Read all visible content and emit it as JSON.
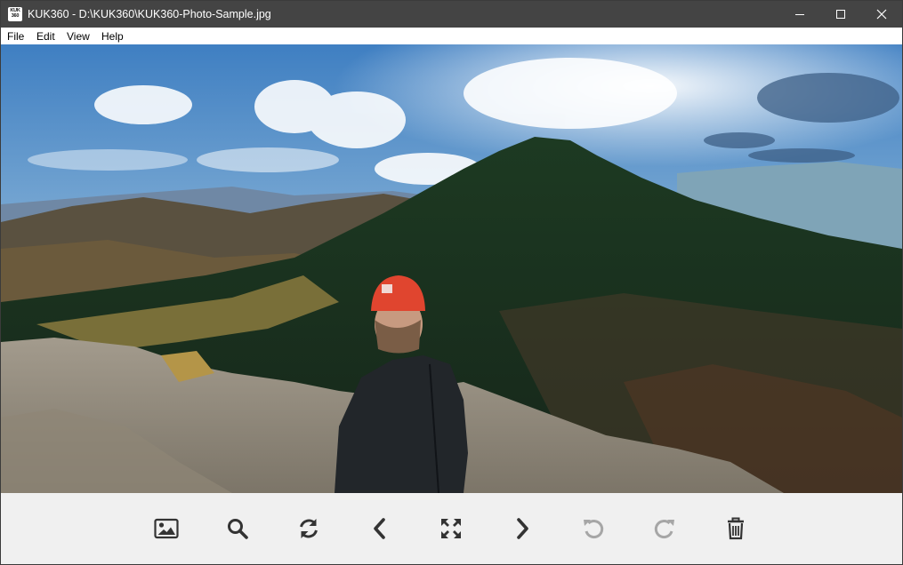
{
  "window": {
    "title": "KUK360 - D:\\KUK360\\KUK360-Photo-Sample.jpg",
    "app_icon_text": "KUK 360",
    "controls": [
      "minimize-icon",
      "maximize-icon",
      "close-icon"
    ]
  },
  "menu": {
    "items": [
      {
        "label": "File"
      },
      {
        "label": "Edit"
      },
      {
        "label": "View"
      },
      {
        "label": "Help"
      }
    ]
  },
  "viewer": {
    "image_subject": "panorama selfie on mountain summit"
  },
  "toolbar": {
    "buttons": [
      {
        "icon": "image-icon",
        "enabled": true
      },
      {
        "icon": "search-icon",
        "enabled": true
      },
      {
        "icon": "refresh-icon",
        "enabled": true
      },
      {
        "icon": "previous-icon",
        "enabled": true
      },
      {
        "icon": "fullscreen-icon",
        "enabled": true
      },
      {
        "icon": "next-icon",
        "enabled": true
      },
      {
        "icon": "rotate-left-icon",
        "enabled": false
      },
      {
        "icon": "rotate-right-icon",
        "enabled": false
      },
      {
        "icon": "trash-icon",
        "enabled": true
      }
    ],
    "colors": {
      "enabled": "#333333",
      "disabled": "#a6a6a6"
    }
  },
  "colors": {
    "titlebar": "#444444",
    "menubar": "#ffffff",
    "toolbar": "#f0f0f0"
  }
}
